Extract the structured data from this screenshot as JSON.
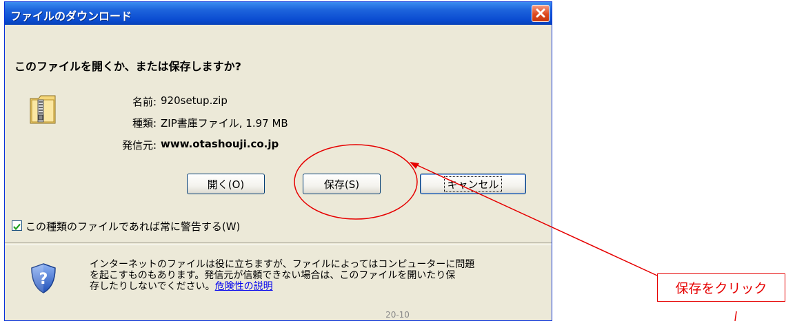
{
  "dialog": {
    "title": "ファイルのダウンロード",
    "question": "このファイルを開くか、または保存しますか?",
    "info": {
      "name_label": "名前:",
      "name_value": "920setup.zip",
      "type_label": "種類:",
      "type_value": "ZIP書庫ファイル, 1.97 MB",
      "from_label": "発信元:",
      "from_value": "www.otashouji.co.jp"
    },
    "buttons": {
      "open": "開く(O)",
      "save": "保存(S)",
      "cancel": "キャンセル"
    },
    "checkbox": {
      "label": "この種類のファイルであれば常に警告する(W)",
      "checked": true
    },
    "warning": {
      "line1": "インターネットのファイルは役に立ちますが、ファイルによってはコンピューターに問題",
      "line2": "を起こすものもあります。発信元が信頼できない場合は、このファイルを開いたり保",
      "line3": "存したりしないでください。",
      "link": "危険性の説明"
    }
  },
  "annotation": {
    "callout_text": "保存をクリック",
    "color": "#e60000"
  },
  "icons": {
    "file": "zip-folder-icon",
    "shield": "security-shield-icon",
    "close": "close-icon"
  },
  "watermark": "20-10"
}
